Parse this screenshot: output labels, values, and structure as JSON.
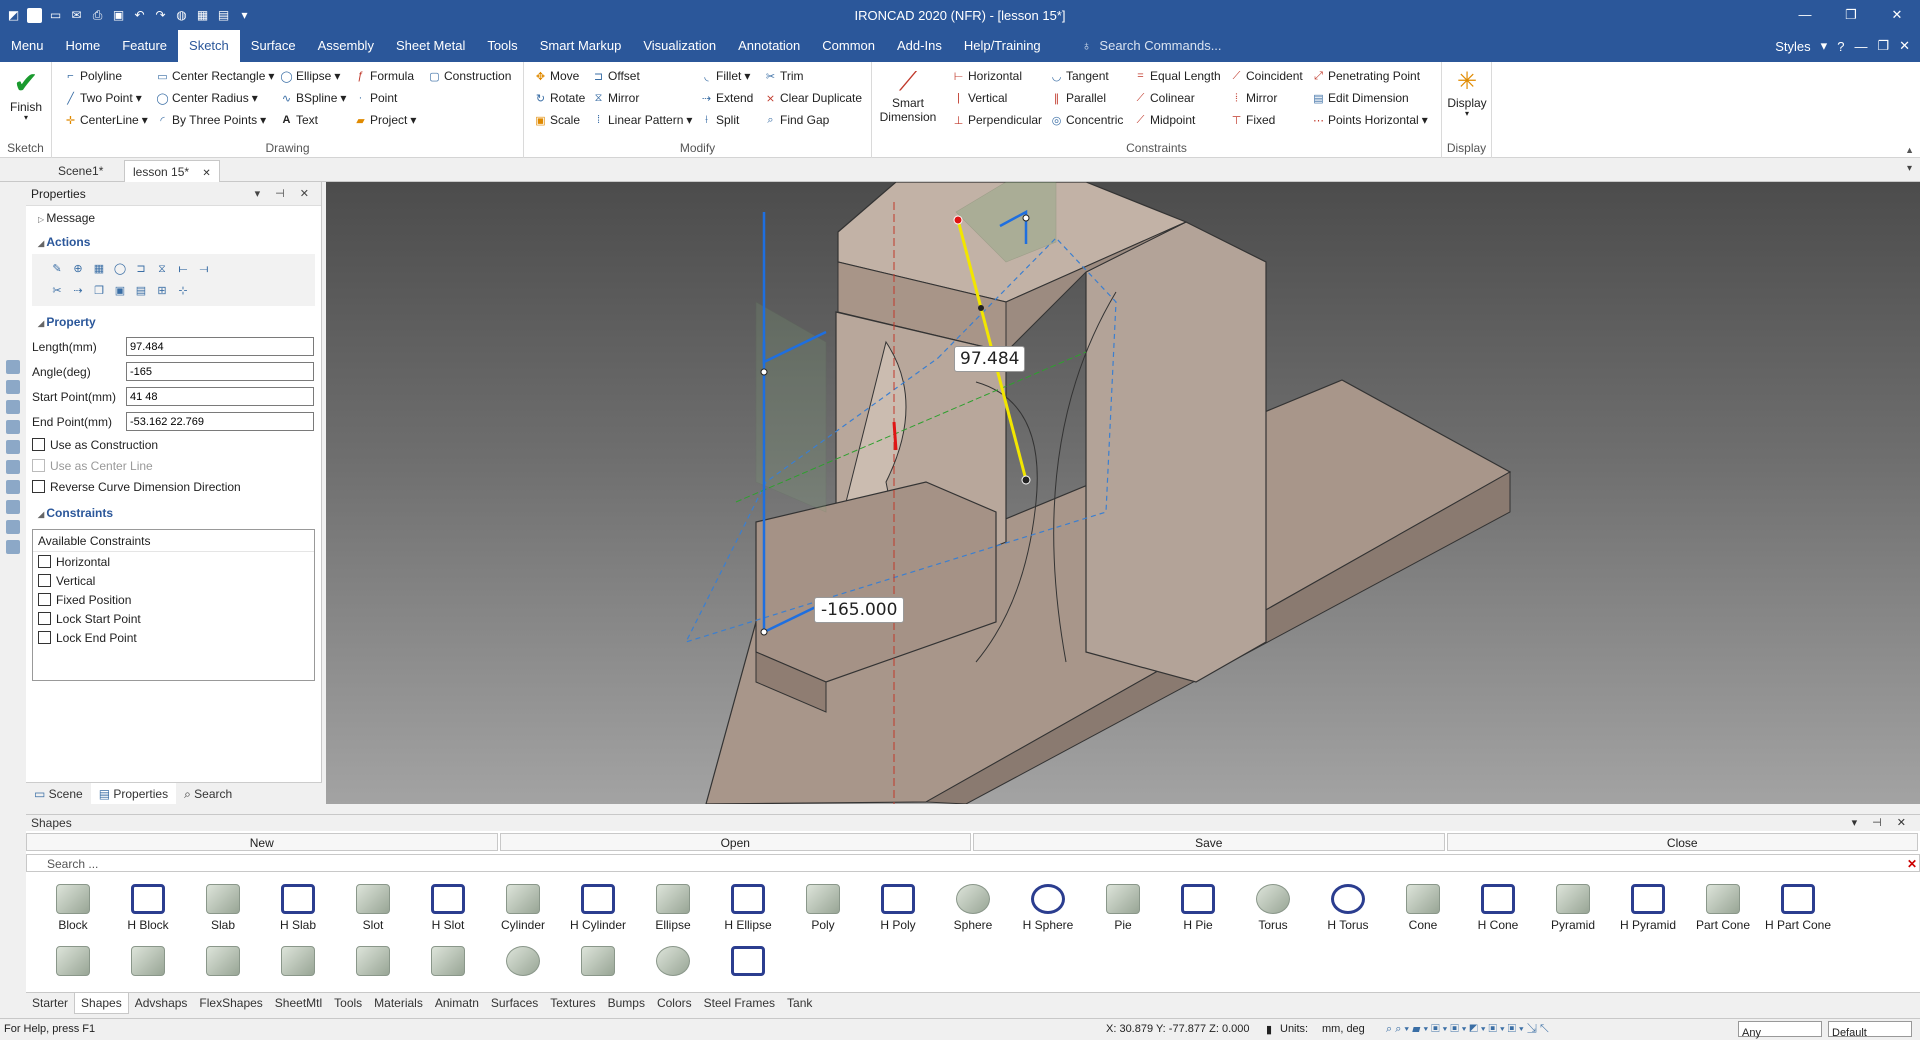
{
  "app": {
    "title": "IRONCAD 2020 (NFR) - [lesson 15*]"
  },
  "menu_tabs": [
    "Menu",
    "Home",
    "Feature",
    "Sketch",
    "Surface",
    "Assembly",
    "Sheet Metal",
    "Tools",
    "Smart Markup",
    "Visualization",
    "Annotation",
    "Common",
    "Add-Ins",
    "Help/Training"
  ],
  "search_commands_placeholder": "Search Commands...",
  "styles_label": "Styles",
  "ribbon": {
    "finish": "Finish",
    "sketch_group": "Sketch",
    "drawing_group": "Drawing",
    "modify_group": "Modify",
    "constraints_group": "Constraints",
    "display_group": "Display",
    "smart_dimension": "Smart Dimension",
    "display": "Display",
    "drawing": [
      "Polyline",
      "Center Rectangle",
      "Ellipse",
      "Formula",
      "Construction",
      "Two Point",
      "Center Radius",
      "BSpline",
      "Point",
      "CenterLine",
      "By Three Points",
      "Text",
      "Project"
    ],
    "modify": [
      "Move",
      "Offset",
      "Fillet",
      "Trim",
      "Rotate",
      "Mirror",
      "Extend",
      "Clear Duplicate",
      "Scale",
      "Linear Pattern",
      "Split",
      "Find Gap"
    ],
    "constraints": [
      "Horizontal",
      "Tangent",
      "Equal Length",
      "Coincident",
      "Penetrating Point",
      "Vertical",
      "Parallel",
      "Colinear",
      "Mirror",
      "Edit Dimension",
      "Perpendicular",
      "Concentric",
      "Midpoint",
      "Fixed",
      "Points Horizontal"
    ]
  },
  "doc_tabs": [
    "Scene1*",
    "lesson 15*"
  ],
  "properties": {
    "panel_title": "Properties",
    "message": "Message",
    "actions": "Actions",
    "property": "Property",
    "length_label": "Length(mm)",
    "length_value": "97.484",
    "angle_label": "Angle(deg)",
    "angle_value": "-165",
    "start_label": "Start Point(mm)",
    "start_value": "41 48",
    "end_label": "End Point(mm)",
    "end_value": "-53.162 22.769",
    "use_construction": "Use as Construction",
    "use_center_line": "Use as Center Line",
    "reverse_curve": "Reverse Curve Dimension Direction",
    "constraints": "Constraints",
    "available_constraints": "Available Constraints",
    "constraint_items": [
      "Horizontal",
      "Vertical",
      "Fixed Position",
      "Lock Start Point",
      "Lock End Point"
    ],
    "tabs": [
      "Scene",
      "Properties",
      "Search"
    ]
  },
  "viewport": {
    "dim_length": "97.484",
    "dim_angle": "-165.000"
  },
  "shapes": {
    "title": "Shapes",
    "buttons": [
      "New",
      "Open",
      "Save",
      "Close"
    ],
    "search_placeholder": "Search ...",
    "items": [
      "Block",
      "H Block",
      "Slab",
      "H Slab",
      "Slot",
      "H Slot",
      "Cylinder",
      "H Cylinder",
      "Ellipse",
      "H Ellipse",
      "Poly",
      "H Poly",
      "Sphere",
      "H Sphere",
      "Pie",
      "H Pie",
      "Torus",
      "H Torus",
      "Cone",
      "H Cone",
      "Pyramid",
      "H Pyramid",
      "Part Cone",
      "H Part Cone"
    ],
    "library_tabs": [
      "Starter",
      "Shapes",
      "Advshaps",
      "FlexShapes",
      "SheetMtl",
      "Tools",
      "Materials",
      "Animatn",
      "Surfaces",
      "Textures",
      "Bumps",
      "Colors",
      "Steel Frames",
      "Tank"
    ]
  },
  "status": {
    "help": "For Help, press F1",
    "coords": "X: 30.879 Y: -77.877 Z: 0.000",
    "units_label": "Units:",
    "units_value": "mm, deg",
    "filter": "Any",
    "style": "Default"
  }
}
